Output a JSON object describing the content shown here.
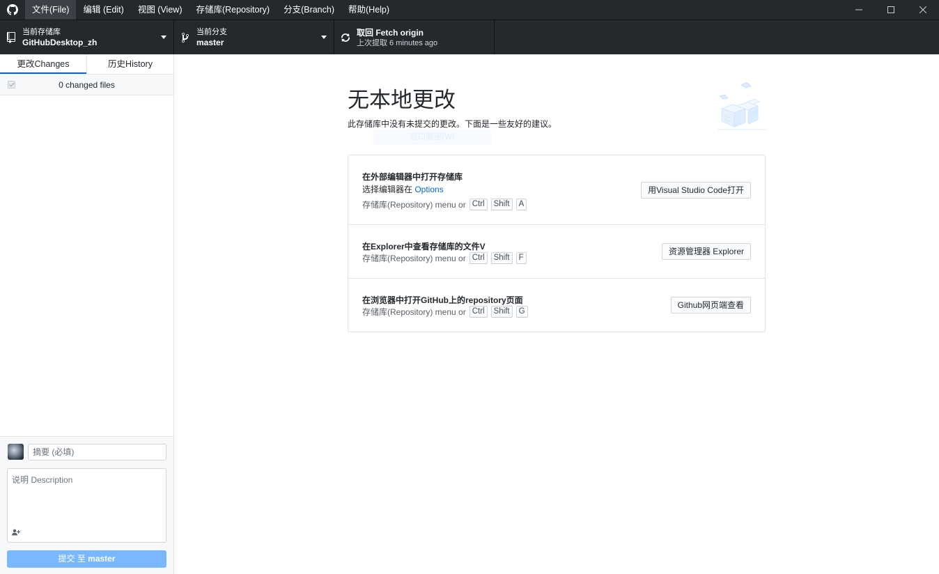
{
  "titlebar": {
    "logo_icon": "github-icon",
    "menu": [
      {
        "label": "文件(File)"
      },
      {
        "label": "编辑 (Edit)"
      },
      {
        "label": "视图 (View)"
      },
      {
        "label": "存储库(Repository)"
      },
      {
        "label": "分支(Branch)"
      },
      {
        "label": "帮助(Help)"
      }
    ],
    "controls": {
      "minimize": "—",
      "maximize": "☐",
      "close": "✕"
    }
  },
  "toolbar": {
    "repo": {
      "label": "当前存储库",
      "value": "GitHubDesktop_zh",
      "icon": "repo-icon"
    },
    "branch": {
      "label": "当前分支",
      "value": "master",
      "icon": "branch-icon"
    },
    "fetch": {
      "label": "取回 Fetch origin",
      "sub": "上次提取 6 minutes ago",
      "icon": "sync-icon"
    }
  },
  "sidebar": {
    "tabs": [
      {
        "label": "更改Changes",
        "selected": true
      },
      {
        "label": "历史History",
        "selected": false
      }
    ],
    "changed_files": "0 changed files",
    "commit": {
      "summary_placeholder": "摘要 (必填)",
      "description_placeholder": "说明 Description",
      "button_prefix": "提交 至 ",
      "button_branch": "master"
    }
  },
  "main": {
    "title": "无本地更改",
    "subtitle": "此存储库中没有未提交的更改。下面是一些友好的建议。",
    "ghost_tooltip": "窗口截图(W)",
    "suggestions": [
      {
        "title": "在外部编辑器中打开存储库",
        "desc_prefix": "选择编辑器在 ",
        "desc_link": "Options",
        "hint": "存储库(Repository) menu or",
        "keys": [
          "Ctrl",
          "Shift",
          "A"
        ],
        "button": "用Visual Studio Code打开"
      },
      {
        "title": "在Explorer中查看存储库的文件V",
        "hint": "存储库(Repository) menu or",
        "keys": [
          "Ctrl",
          "Shift",
          "F"
        ],
        "button": "资源管理器 Explorer"
      },
      {
        "title": "在浏览器中打开GitHub上的repository页面",
        "hint": "存储库(Repository) menu or",
        "keys": [
          "Ctrl",
          "Shift",
          "G"
        ],
        "button": "Github网页端查看"
      }
    ]
  },
  "colors": {
    "chrome": "#24292e",
    "accent": "#0366d6",
    "commit_button": "#79b8ff"
  }
}
